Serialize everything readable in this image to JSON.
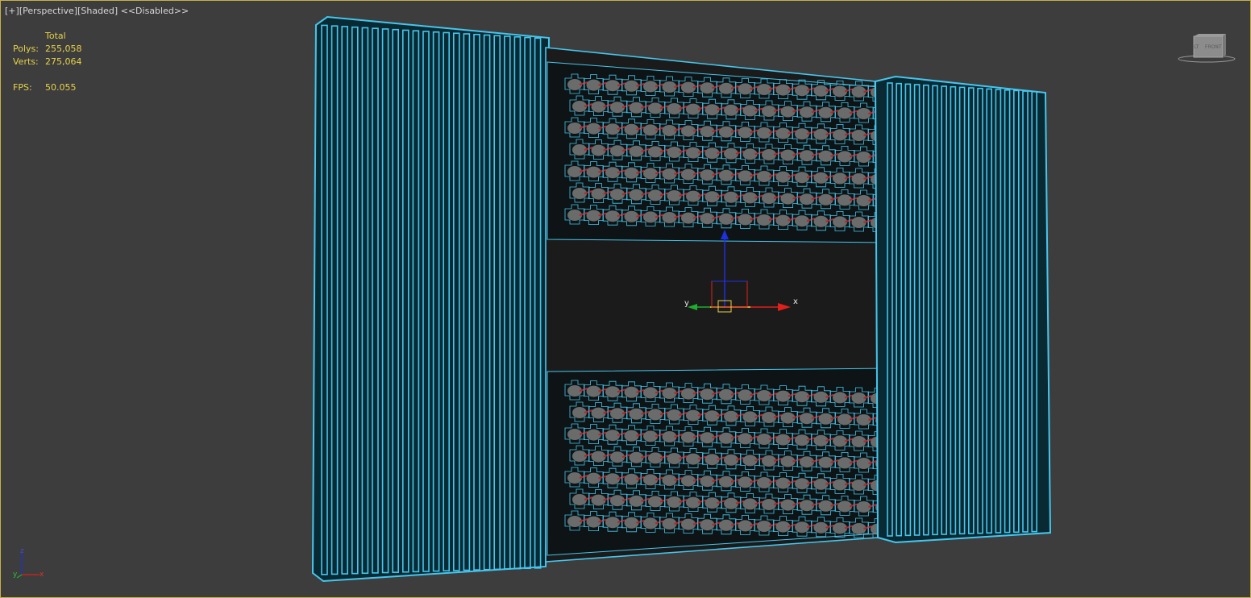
{
  "viewport_label": {
    "plus": "[+]",
    "view": "[Perspective]",
    "shading": "[Shaded]",
    "status": "<<Disabled>>"
  },
  "stats": {
    "header": "Total",
    "polys_label": "Polys:",
    "polys_value": "255,058",
    "verts_label": "Verts:",
    "verts_value": "275,064",
    "fps_label": "FPS:",
    "fps_value": "50.055"
  },
  "viewcube": {
    "face_left": "LT",
    "face_front": "FRONT"
  },
  "gizmo": {
    "x_label": "x",
    "y_label": "y"
  },
  "tripod": {
    "z_label": "z",
    "y_label": "y",
    "x_label": "x"
  },
  "colors": {
    "background": "#3d3d3d",
    "wireframe": "#45c6ee",
    "stats_text": "#e6d24a",
    "viewport_border": "#c8b04a",
    "axis_x": "#e0201a",
    "axis_y": "#1fae2e",
    "axis_z": "#2030e0"
  }
}
